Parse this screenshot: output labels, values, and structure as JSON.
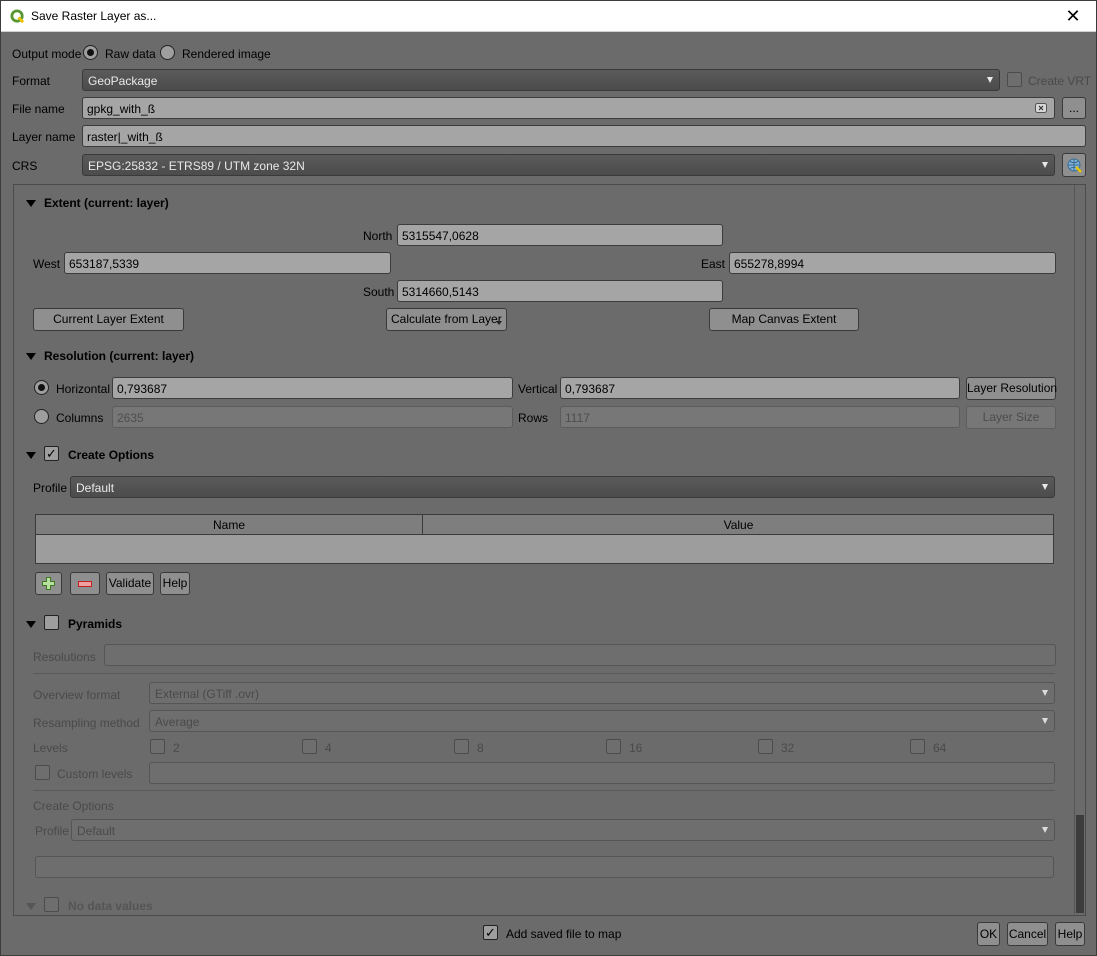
{
  "window": {
    "title": "Save Raster Layer as...",
    "close_glyph": "✕"
  },
  "form": {
    "output_mode_label": "Output mode",
    "raw_data": "Raw data",
    "rendered_image": "Rendered image",
    "format_label": "Format",
    "format_value": "GeoPackage",
    "create_vrt": "Create VRT",
    "file_name_label": "File name",
    "file_name_value": "gpkg_with_ß",
    "browse": "...",
    "layer_name_label": "Layer name",
    "layer_name_value": "raster|_with_ß",
    "crs_label": "CRS",
    "crs_value": "EPSG:25832 - ETRS89 / UTM zone 32N"
  },
  "extent": {
    "title": "Extent (current: layer)",
    "north_label": "North",
    "north_value": "5315547,0628",
    "west_label": "West",
    "west_value": "653187,5339",
    "east_label": "East",
    "east_value": "655278,8994",
    "south_label": "South",
    "south_value": "5314660,5143",
    "current_layer_extent": "Current Layer Extent",
    "calculate_from_layer": "Calculate from Layer",
    "map_canvas_extent": "Map Canvas Extent"
  },
  "resolution": {
    "title": "Resolution (current: layer)",
    "horizontal_label": "Horizontal",
    "horizontal_value": "0,793687",
    "vertical_label": "Vertical",
    "vertical_value": "0,793687",
    "layer_resolution": "Layer Resolution",
    "columns_label": "Columns",
    "columns_value": "2635",
    "rows_label": "Rows",
    "rows_value": "1117",
    "layer_size": "Layer Size"
  },
  "create_options": {
    "title": "Create Options",
    "profile_label": "Profile",
    "profile_value": "Default",
    "col_name": "Name",
    "col_value": "Value",
    "validate": "Validate",
    "help": "Help"
  },
  "pyramids": {
    "title": "Pyramids",
    "resolutions_label": "Resolutions",
    "overview_format_label": "Overview format",
    "overview_format_value": "External (GTiff .ovr)",
    "resampling_label": "Resampling method",
    "resampling_value": "Average",
    "levels_label": "Levels",
    "levels": [
      "2",
      "4",
      "8",
      "16",
      "32",
      "64"
    ],
    "custom_levels": "Custom levels",
    "create_options_label": "Create Options",
    "profile_label": "Profile",
    "profile_value": "Default"
  },
  "nodata": {
    "title": "No data values"
  },
  "footer": {
    "add_to_map": "Add saved file to map",
    "ok": "OK",
    "cancel": "Cancel",
    "help": "Help"
  },
  "colors": {
    "accent": "#589632",
    "dialog_bg": "#6b6b6b",
    "field_bg": "#a5a5a5"
  }
}
